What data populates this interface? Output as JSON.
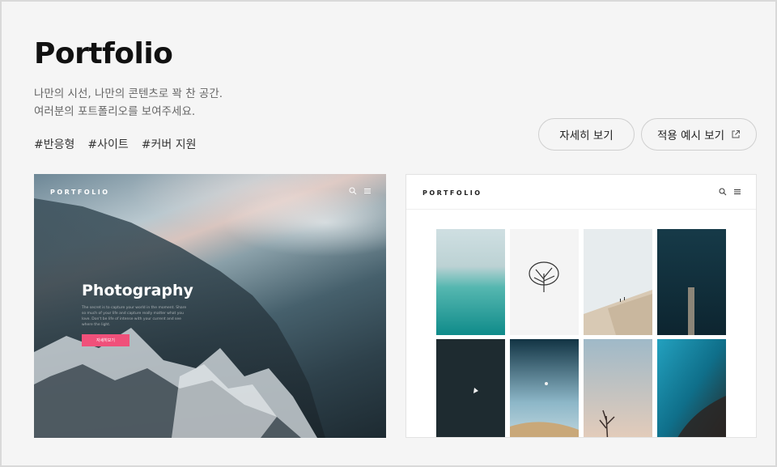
{
  "card": {
    "title": "Portfolio",
    "description_lines": [
      "나만의 시선, 나만의 콘텐츠로 꽉 찬 공간.",
      "여러분의 포트폴리오를 보여주세요."
    ],
    "tags": [
      "#반응형",
      "#사이트",
      "#커버 지원"
    ],
    "buttons": {
      "detail": "자세히 보기",
      "example": "적용 예시 보기"
    }
  },
  "preview_left": {
    "logo": "PORTFOLIO",
    "heading": "Photography",
    "body": "The secret is to capture your world in the moment. Share so much of your life and capture really matter what you love. Don't be life of intense with your current and see where the light.",
    "cta": "자세히보기"
  },
  "preview_right": {
    "logo": "PORTFOLIO",
    "thumbnails": [
      "sea-turquoise",
      "lone-tree",
      "desert-dune-figures",
      "pier-dark-sea",
      "dark-water-boat",
      "dune-moon-sky",
      "branch-sky",
      "aerial-turquoise-coast"
    ]
  },
  "colors": {
    "accent": "#f0507a",
    "card_bg": "#f5f5f5",
    "border": "#d9d9d9"
  }
}
